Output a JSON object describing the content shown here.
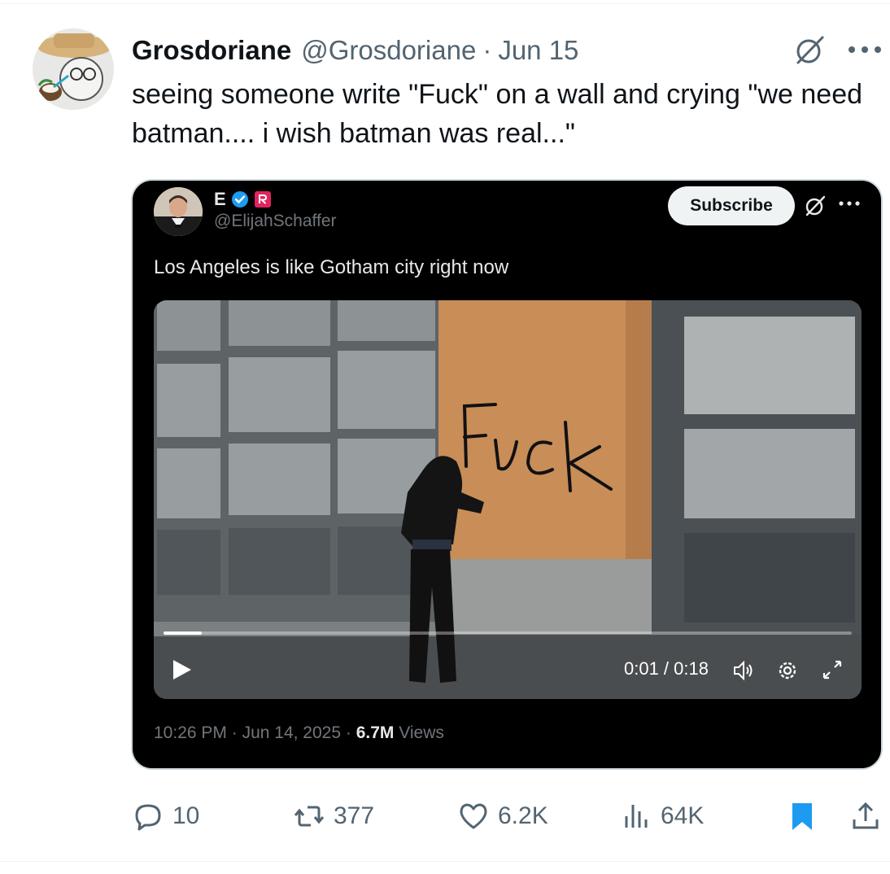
{
  "tweet": {
    "author_name": "Grosdoriane",
    "handle": "@Grosdoriane",
    "separator": "·",
    "date": "Jun 15",
    "text": "seeing someone write \"Fuck\" on a wall and crying \"we need batman.... i wish batman was real...\""
  },
  "quote": {
    "author_initial": "E",
    "handle": "@ElijahSchaffer",
    "subscribe_label": "Subscribe",
    "text": "Los Angeles is like Gotham city right now",
    "video": {
      "wall_text": "FUCK",
      "time": "0:01 / 0:18",
      "progress_fraction": 0.056
    },
    "meta_time": "10:26 PM",
    "meta_sep": "·",
    "meta_date": "Jun 14, 2025",
    "views_count": "6.7M",
    "views_label": "Views"
  },
  "actions": {
    "replies": "10",
    "reposts": "377",
    "likes": "6.2K",
    "views": "64K"
  },
  "colors": {
    "text_primary": "#0f1419",
    "text_secondary": "#536471",
    "verified_blue": "#1d9bf0",
    "bookmark_blue": "#1d9bf0",
    "quote_bg": "#000000",
    "badge_red": "#e0245e"
  },
  "icons": [
    "grok-icon",
    "more-icon",
    "verified-badge-icon",
    "affiliate-badge-icon",
    "play-icon",
    "volume-icon",
    "settings-icon",
    "fullscreen-icon",
    "reply-icon",
    "repost-icon",
    "like-icon",
    "views-icon",
    "bookmark-icon",
    "share-icon"
  ]
}
